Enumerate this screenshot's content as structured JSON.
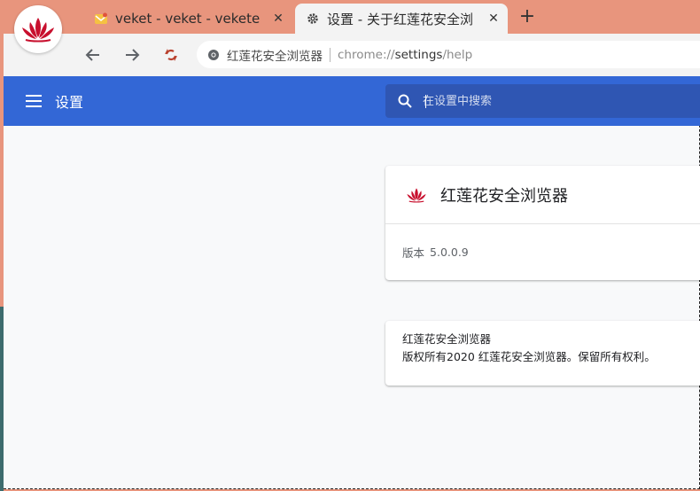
{
  "browser": {
    "logo_icon": "lotus-logo-icon"
  },
  "tabs": [
    {
      "title": "veket - veket - vekete",
      "icon": "mail-icon",
      "close_label": "✕",
      "active": false
    },
    {
      "title": "设置 - 关于红莲花安全浏",
      "icon": "gear-icon",
      "close_label": "✕",
      "active": true
    }
  ],
  "new_tab_label": "+",
  "toolbar": {
    "back_icon": "arrow-left-icon",
    "forward_icon": "arrow-right-icon",
    "extension_icon": "sync-icon"
  },
  "omnibox": {
    "site_name": "红莲花安全浏览器",
    "url_scheme": "chrome://",
    "url_host": "settings",
    "url_path": "/help"
  },
  "settings": {
    "title": "设置",
    "search_placeholder": "在设置中搜索"
  },
  "about": {
    "product_name": "红莲花安全浏览器",
    "version_label": "版本",
    "version_value": "5.0.0.9"
  },
  "copyright": {
    "line1": "红莲花安全浏览器",
    "line2": "版权所有2020 红莲花安全浏览器。保留所有权利。"
  },
  "colors": {
    "accent": "#3367d6",
    "frame": "#e8957d",
    "brand_red": "#c8102e"
  }
}
